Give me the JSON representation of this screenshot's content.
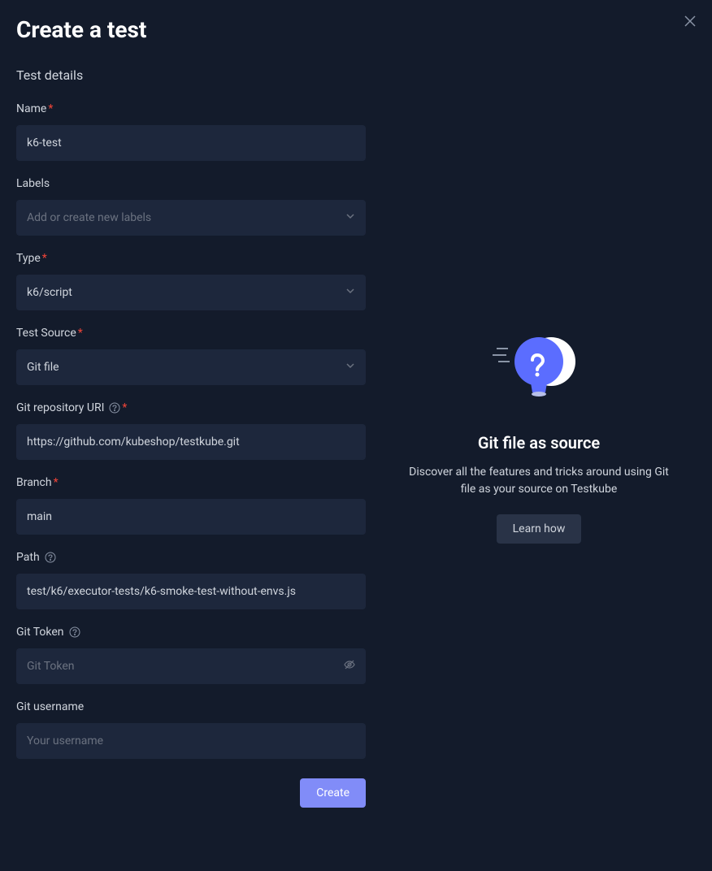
{
  "modal": {
    "title": "Create a test",
    "close": "×"
  },
  "form": {
    "section_title": "Test details",
    "name": {
      "label": "Name",
      "value": "k6-test"
    },
    "labels": {
      "label": "Labels",
      "placeholder": "Add or create new labels",
      "value": ""
    },
    "type": {
      "label": "Type",
      "value": "k6/script"
    },
    "test_source": {
      "label": "Test Source",
      "value": "Git file"
    },
    "git_uri": {
      "label": "Git repository URI",
      "value": "https://github.com/kubeshop/testkube.git"
    },
    "branch": {
      "label": "Branch",
      "value": "main"
    },
    "path": {
      "label": "Path",
      "value": "test/k6/executor-tests/k6-smoke-test-without-envs.js"
    },
    "git_token": {
      "label": "Git Token",
      "placeholder": "Git Token",
      "value": ""
    },
    "git_username": {
      "label": "Git username",
      "placeholder": "Your username",
      "value": ""
    },
    "create_button": "Create"
  },
  "info": {
    "title": "Git file as source",
    "description": "Discover all the features and tricks around using Git file as your source on Testkube",
    "learn_button": "Learn how"
  }
}
